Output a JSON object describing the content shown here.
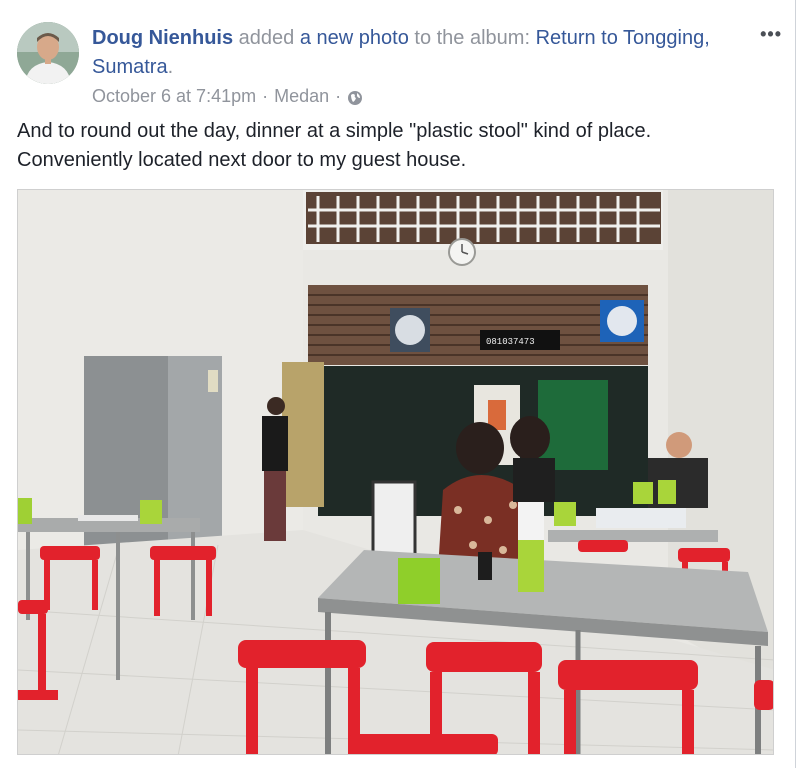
{
  "post": {
    "author": "Doug Nienhuis",
    "action_text": " added ",
    "object_link": "a new photo",
    "album_prefix": " to the album: ",
    "album_name": "Return to Tongging, Sumatra",
    "album_suffix": ".",
    "date": "October 6 at 7:41pm",
    "separator1": "·",
    "location": "Medan",
    "separator2": "·",
    "privacy_icon": "globe-icon",
    "more_icon": "more-options-icon",
    "more_label": "•••",
    "text_line1": "And to round out the day, dinner at a simple \"plastic stool\" kind of place.",
    "text_line2": "Conveniently located next door to my guest house.",
    "photo_sign_text": "081037473"
  },
  "colors": {
    "link": "#365899",
    "meta": "#90949c",
    "text": "#1d2129"
  }
}
